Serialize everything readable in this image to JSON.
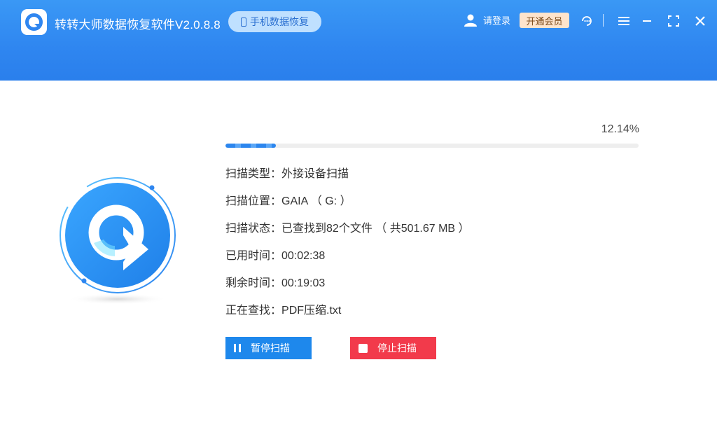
{
  "header": {
    "app_title": "转转大师数据恢复软件V2.0.8.8",
    "mode_button": "手机数据恢复",
    "login_label": "请登录",
    "vip_button": "开通会员"
  },
  "scan": {
    "progress_text": "12.14%",
    "progress_fraction": 0.1214,
    "rows": [
      {
        "label": "扫描类型：",
        "value": "外接设备扫描"
      },
      {
        "label": "扫描位置：",
        "value": "GAIA （ G: ）"
      },
      {
        "label": "扫描状态：",
        "value": "已查找到82个文件 （ 共501.67 MB ）"
      },
      {
        "label": "已用时间：",
        "value": "00:02:38"
      },
      {
        "label": "剩余时间：",
        "value": "00:19:03"
      },
      {
        "label": "正在查找：",
        "value": "PDF压缩.txt"
      }
    ],
    "pause_button": "暂停扫描",
    "stop_button": "停止扫描"
  },
  "icons": [
    "app-logo-icon",
    "phone-icon",
    "user-icon",
    "support-icon",
    "menu-icon",
    "minimize-icon",
    "maximize-icon",
    "close-icon",
    "pause-icon",
    "stop-icon"
  ],
  "colors": {
    "header_blue": "#2f86f0",
    "pause_blue": "#1e88ec",
    "stop_red": "#f23a4b",
    "vip_bg": "#fde4cc"
  }
}
